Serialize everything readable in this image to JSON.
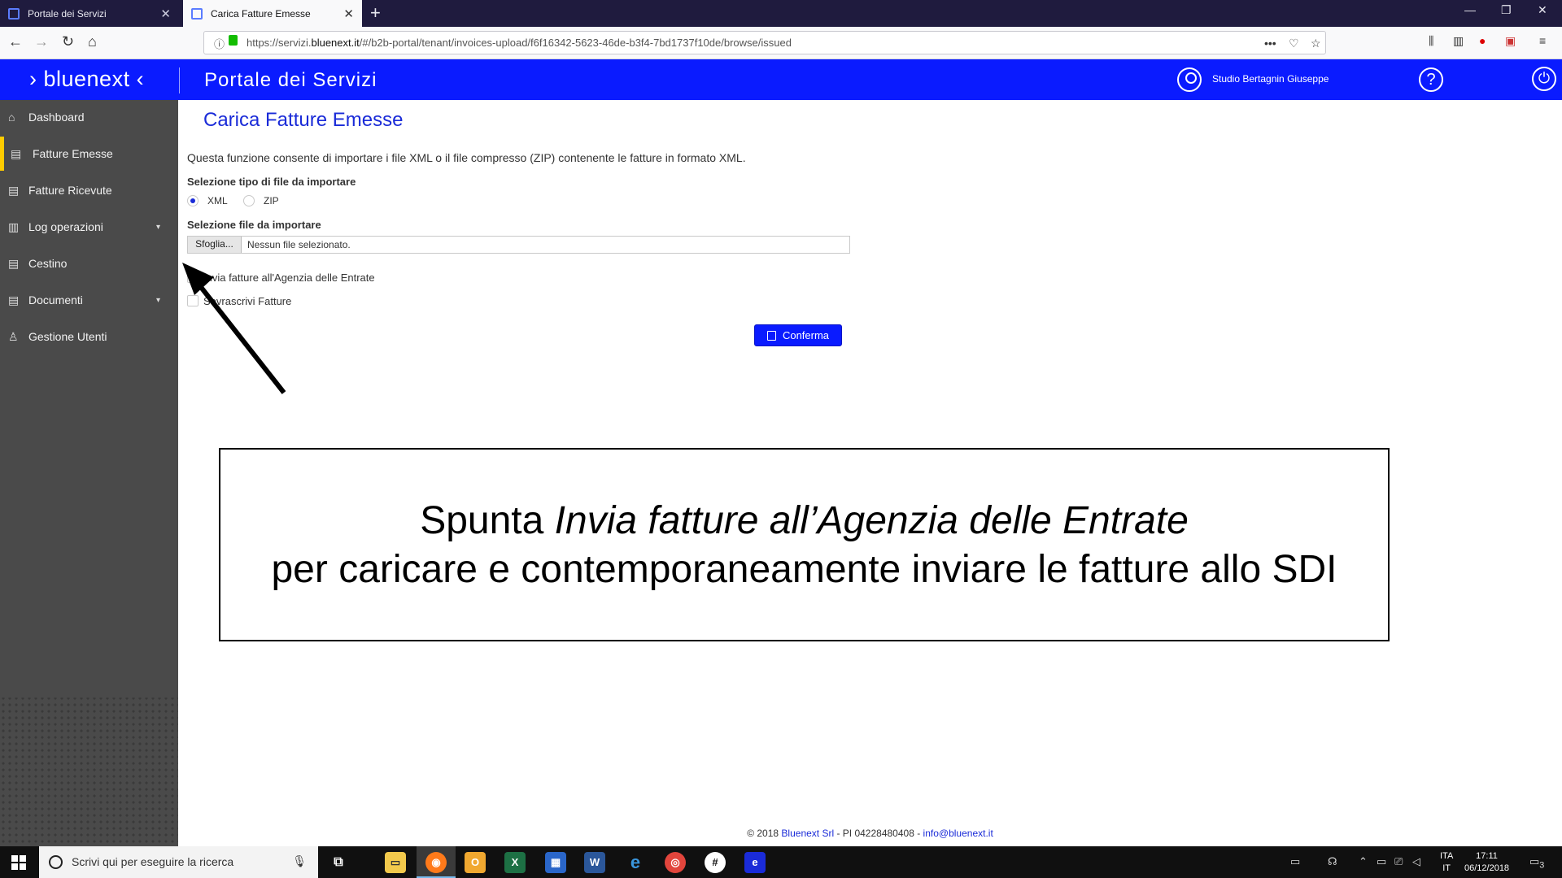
{
  "browser": {
    "tabs": [
      {
        "title": "Portale dei Servizi"
      },
      {
        "title": "Carica Fatture Emesse"
      }
    ],
    "url_prefix": "https://servizi.",
    "url_host": "bluenext.it",
    "url_path": "/#/b2b-portal/tenant/invoices-upload/f6f16342-5623-46de-b3f4-7bd1737f10de/browse/issued"
  },
  "header": {
    "logo": "› bluenext ‹",
    "portal_title": "Portale dei Servizi",
    "user_name": "Studio Bertagnin Giuseppe",
    "help_glyph": "?",
    "power_glyph": "⏻"
  },
  "sidebar": {
    "items": [
      {
        "label": "Dashboard",
        "icon": "home-icon",
        "glyph": "⌂"
      },
      {
        "label": "Fatture Emesse",
        "icon": "document-icon",
        "glyph": "▤",
        "active": true
      },
      {
        "label": "Fatture Ricevute",
        "icon": "document-icon",
        "glyph": "▤"
      },
      {
        "label": "Log operazioni",
        "icon": "log-icon",
        "glyph": "▥",
        "has_submenu": true
      },
      {
        "label": "Cestino",
        "icon": "trash-document-icon",
        "glyph": "▤"
      },
      {
        "label": "Documenti",
        "icon": "documents-icon",
        "glyph": "▤",
        "has_submenu": true
      },
      {
        "label": "Gestione Utenti",
        "icon": "user-icon",
        "glyph": "♙"
      }
    ],
    "caret": "▾"
  },
  "main": {
    "title": "Carica Fatture Emesse",
    "intro": "Questa funzione consente di importare i file XML o il file compresso (ZIP) contenente le fatture in formato XML.",
    "file_type_label": "Selezione tipo di file da importare",
    "file_type_options": [
      "XML",
      "ZIP"
    ],
    "file_type_selected": "XML",
    "file_label": "Selezione file da importare",
    "browse_label": "Sfoglia...",
    "file_status": "Nessun file selezionato.",
    "checkbox_send": "Invia fatture all'Agenzia delle Entrate",
    "checkbox_overwrite": "Sovrascrivi Fatture",
    "confirm_label": "Conferma"
  },
  "callout": {
    "line1_prefix": "Spunta ",
    "line1_italic": "Invia fatture all’Agenzia delle Entrate",
    "line2": "per caricare e contemporaneamente inviare le fatture allo SDI"
  },
  "footer": {
    "prefix": "© 2018 ",
    "company": "Bluenext Srl",
    "middle": " - PI 04228480408 - ",
    "email": "info@bluenext.it"
  },
  "taskbar": {
    "search_placeholder": "Scrivi qui per eseguire la ricerca",
    "lang_line1": "ITA",
    "lang_line2": "IT",
    "time": "17:11",
    "date": "06/12/2018",
    "notifications": "3"
  },
  "colors": {
    "brand_blue": "#0a1bff",
    "sidebar_bg": "#4a4a4a",
    "active_marker": "#ffcc00"
  }
}
